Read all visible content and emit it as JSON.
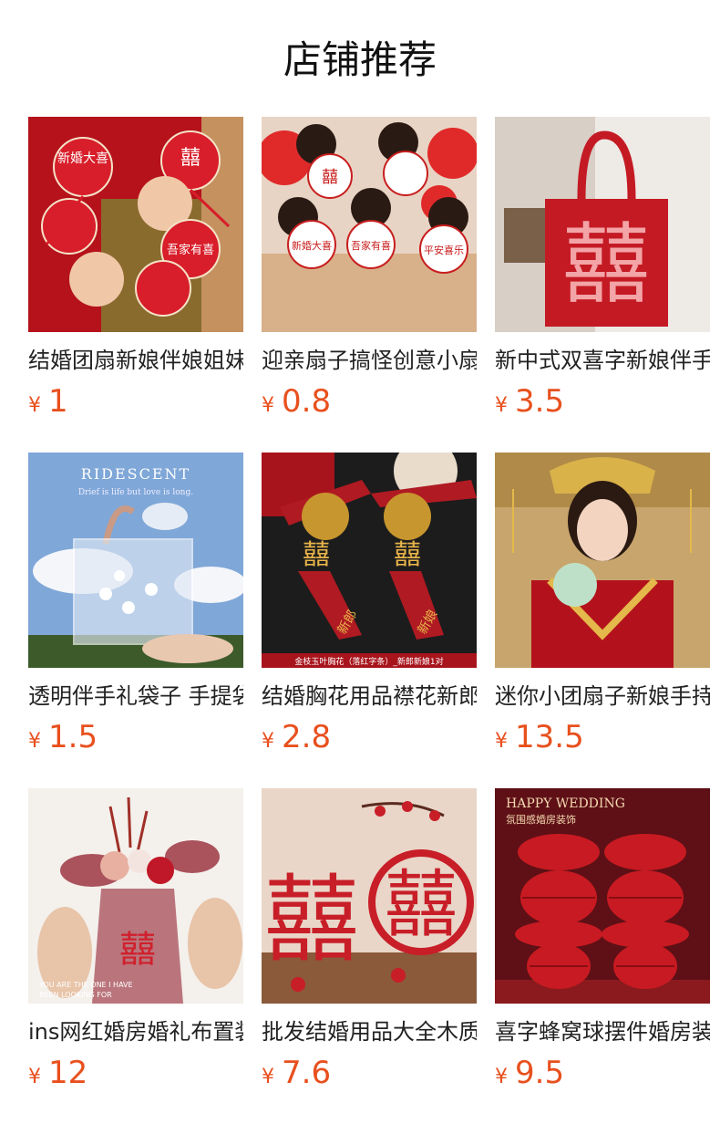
{
  "header": {
    "title": "店铺推荐"
  },
  "products": [
    {
      "name": "结婚团扇新娘伴娘姐妹",
      "currency": "¥",
      "price": "1",
      "image": {
        "icon": "wedding-fan-photo",
        "texts": [
          "新婚大喜",
          "吾家有喜"
        ]
      }
    },
    {
      "name": "迎亲扇子搞怪创意小扇",
      "currency": "¥",
      "price": "0.8",
      "image": {
        "icon": "bridesmaids-fans-photo",
        "texts": [
          "新婚大喜",
          "吾家有喜",
          "平安喜乐"
        ]
      }
    },
    {
      "name": "新中式双喜字新娘伴手",
      "currency": "¥",
      "price": "3.5",
      "image": {
        "icon": "red-felt-bag-photo",
        "texts": [
          "囍"
        ]
      }
    },
    {
      "name": "透明伴手礼袋子 手提袋",
      "currency": "¥",
      "price": "1.5",
      "image": {
        "icon": "clear-gift-bag-photo",
        "texts": [
          "RIDESCENT",
          "Drief is life but love is long."
        ]
      }
    },
    {
      "name": "结婚胸花用品襟花新郎新",
      "currency": "¥",
      "price": "2.8",
      "image": {
        "icon": "corsage-photo",
        "texts": [
          "囍",
          "新郎",
          "新娘",
          "金枝玉叶胸花（落红字条）_新郎新娘1对"
        ]
      }
    },
    {
      "name": "迷你小团扇子新娘手持",
      "currency": "¥",
      "price": "13.5",
      "image": {
        "icon": "bride-portrait-photo",
        "texts": []
      }
    },
    {
      "name": "ins网红婚房婚礼布置装",
      "currency": "¥",
      "price": "12",
      "image": {
        "icon": "bouquet-photo",
        "texts": [
          "囍",
          "YOU ARE THE ONE I HAVE",
          "BEEN LOOKING FOR"
        ]
      }
    },
    {
      "name": "批发结婚用品大全木质",
      "currency": "¥",
      "price": "7.6",
      "image": {
        "icon": "wooden-xi-decor-photo",
        "texts": [
          "囍"
        ]
      }
    },
    {
      "name": "喜字蜂窝球摆件婚房装",
      "currency": "¥",
      "price": "9.5",
      "image": {
        "icon": "honeycomb-ball-photo",
        "texts": [
          "HAPPY WEDDING",
          "氛围感婚房装饰"
        ]
      }
    }
  ],
  "colors": {
    "price": "#e8501e",
    "title": "#111111",
    "name": "#222222"
  }
}
